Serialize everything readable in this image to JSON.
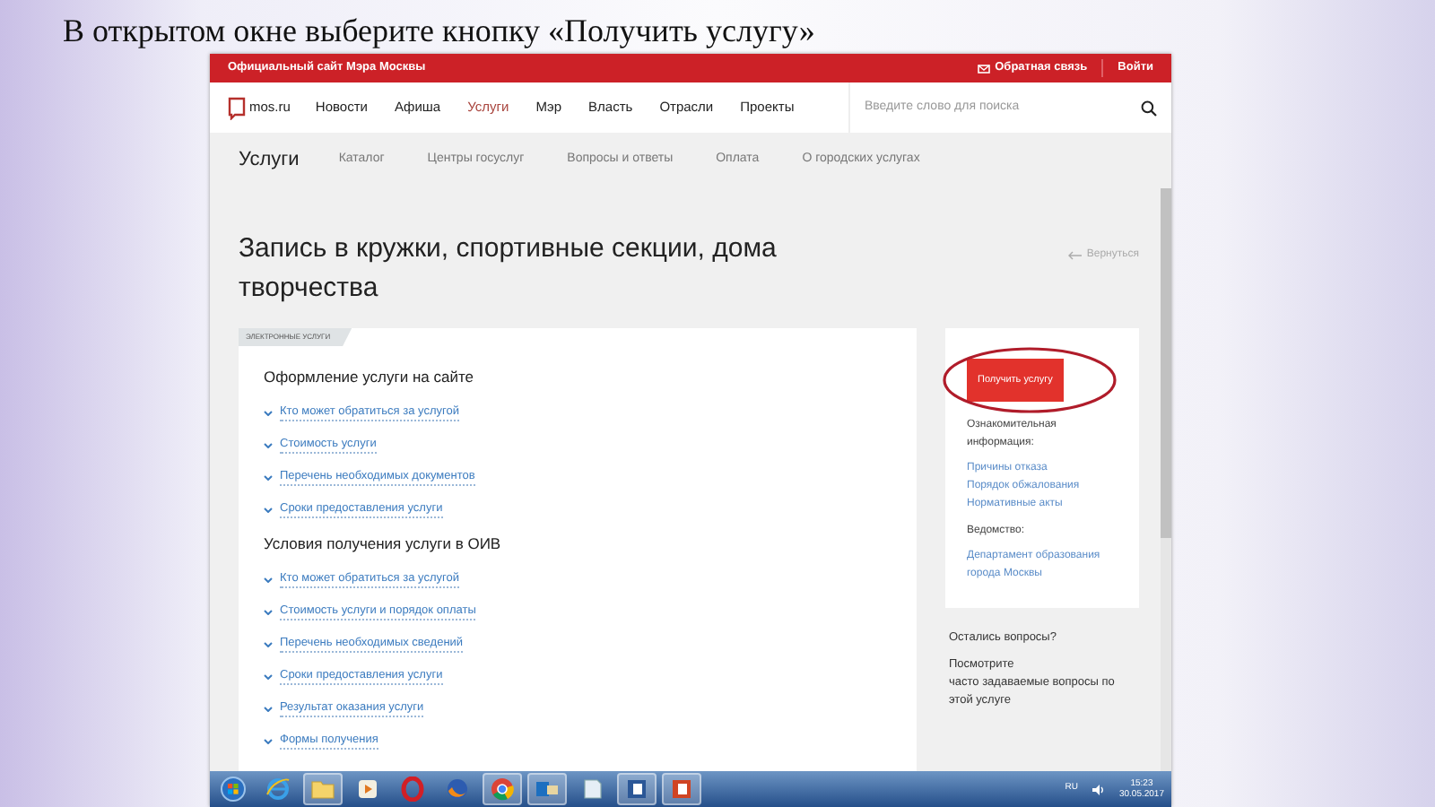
{
  "slide": {
    "title": "В открытом окне выберите кнопку «Получить услугу»"
  },
  "top_bar": {
    "site_label": "Официальный сайт Мэра Москвы",
    "feedback": "Обратная связь",
    "login": "Войти"
  },
  "nav": {
    "logo_text": "mos.ru",
    "items": [
      {
        "label": "Новости",
        "selected": false
      },
      {
        "label": "Афиша",
        "selected": false
      },
      {
        "label": "Услуги",
        "selected": true
      },
      {
        "label": "Мэр",
        "selected": false
      },
      {
        "label": "Власть",
        "selected": false
      },
      {
        "label": "Отрасли",
        "selected": false
      },
      {
        "label": "Проекты",
        "selected": false
      }
    ],
    "search": {
      "placeholder": "Введите слово для поиска"
    }
  },
  "subnav": {
    "title": "Услуги",
    "links": [
      "Каталог",
      "Центры госуслуг",
      "Вопросы и ответы",
      "Оплата",
      "О городских услугах"
    ]
  },
  "page_title": "Запись в кружки, спортивные секции, дома творчества",
  "back_link": "Вернуться",
  "main_card": {
    "tag": "ЭЛЕКТРОННЫЕ УСЛУГИ",
    "sections": [
      {
        "heading": "Оформление услуги на сайте",
        "links": [
          "Кто может обратиться за услугой",
          "Стоимость услуги",
          "Перечень необходимых документов",
          "Сроки предоставления услуги"
        ]
      },
      {
        "heading": "Условия получения услуги в ОИВ",
        "links": [
          "Кто может обратиться за услугой",
          "Стоимость услуги и порядок оплаты",
          "Перечень необходимых сведений",
          "Сроки предоставления услуги",
          "Результат оказания услуги",
          "Формы получения"
        ]
      }
    ]
  },
  "side_card": {
    "button": {
      "label": "Получить услугу",
      "circled": true
    },
    "info_label": "Ознакомительная информация:",
    "info_links": [
      "Причины отказа",
      "Порядок обжалования",
      "Нормативные акты"
    ],
    "agency_label": "Ведомство:",
    "agency_link": "Департамент образования города Москвы"
  },
  "questions": {
    "title": "Остались вопросы?",
    "text_before": "Посмотрите",
    "link": "часто задаваемые вопросы",
    "text_after": "по этой услуге"
  },
  "taskbar": {
    "apps": [
      {
        "kind": "start",
        "running": false
      },
      {
        "kind": "ie",
        "running": false
      },
      {
        "kind": "folder",
        "running": true
      },
      {
        "kind": "media",
        "running": false
      },
      {
        "kind": "opera",
        "running": false
      },
      {
        "kind": "firefox",
        "running": false
      },
      {
        "kind": "chrome",
        "running": true
      },
      {
        "kind": "outlook",
        "running": true
      },
      {
        "kind": "notes",
        "running": false
      },
      {
        "kind": "word",
        "running": true
      },
      {
        "kind": "powerpoint",
        "running": true
      }
    ],
    "language": "RU",
    "time": "15:23",
    "date": "30.05.2017"
  }
}
